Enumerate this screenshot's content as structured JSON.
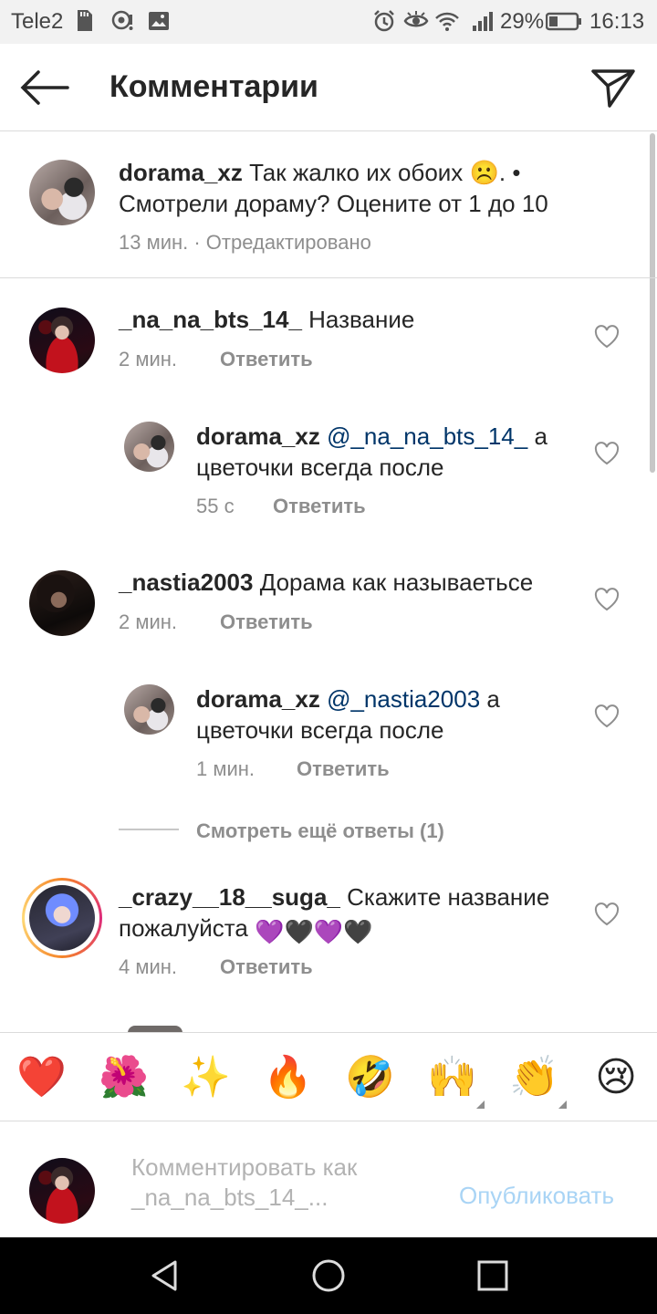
{
  "status_bar": {
    "carrier": "Tele2",
    "battery": "29%",
    "time": "16:13"
  },
  "header": {
    "title": "Комментарии"
  },
  "caption": {
    "username": "dorama_xz",
    "text_line1": "Так жалко их обоих ☹️. •",
    "text_line2": "Смотрели дораму? Оцените от 1 до 10",
    "meta": "13 мин. · Отредактировано"
  },
  "comments": [
    {
      "username": "_na_na_bts_14_",
      "text": "Название",
      "time": "2 мин.",
      "reply_label": "Ответить"
    },
    {
      "username": "dorama_xz",
      "mention": "@_na_na_bts_14_",
      "text_after": "а",
      "text_line2": "цветочки всегда после",
      "time": "55 с",
      "reply_label": "Ответить"
    },
    {
      "username": "_nastia2003",
      "text": "Дорама как называетьсе",
      "time": "2 мин.",
      "reply_label": "Ответить"
    },
    {
      "username": "dorama_xz",
      "mention": "@_nastia2003",
      "text_after": "а",
      "text_line2": "цветочки всегда после",
      "time": "1 мин.",
      "reply_label": "Ответить"
    },
    {
      "username": "_crazy__18__suga_",
      "text": "Скажите название",
      "text_line2": "пожалуйста",
      "emojis": "💜🖤💜🖤",
      "time": "4 мин.",
      "reply_label": "Ответить"
    }
  ],
  "view_more_replies": "Смотреть ещё ответы (1)",
  "emoji_bar": [
    "❤️",
    "🌺",
    "✨",
    "🔥",
    "🤣",
    "🙌",
    "👏",
    "😢"
  ],
  "comment_input": {
    "placeholder_line1": "Комментировать как",
    "placeholder_line2": "_na_na_bts_14_...",
    "publish_label": "Опубликовать"
  },
  "colors": {
    "mention": "#003569",
    "publish_disabled": "#a9d4f5",
    "meta_gray": "#8e8e8e"
  }
}
